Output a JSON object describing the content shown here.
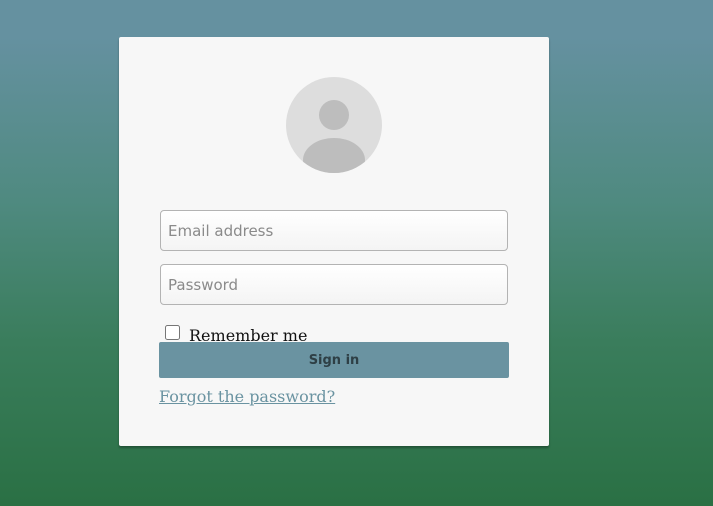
{
  "form": {
    "email_placeholder": "Email address",
    "password_placeholder": "Password",
    "remember_label": "Remember me",
    "remember_checked": false,
    "signin_label": "Sign in",
    "forgot_link": "Forgot the password?"
  },
  "icons": {
    "avatar": "user-avatar-icon"
  },
  "colors": {
    "accent": "#6a93a1",
    "background_top": "#6591a0",
    "background_bottom": "#2a7044",
    "card": "#f7f7f7"
  }
}
